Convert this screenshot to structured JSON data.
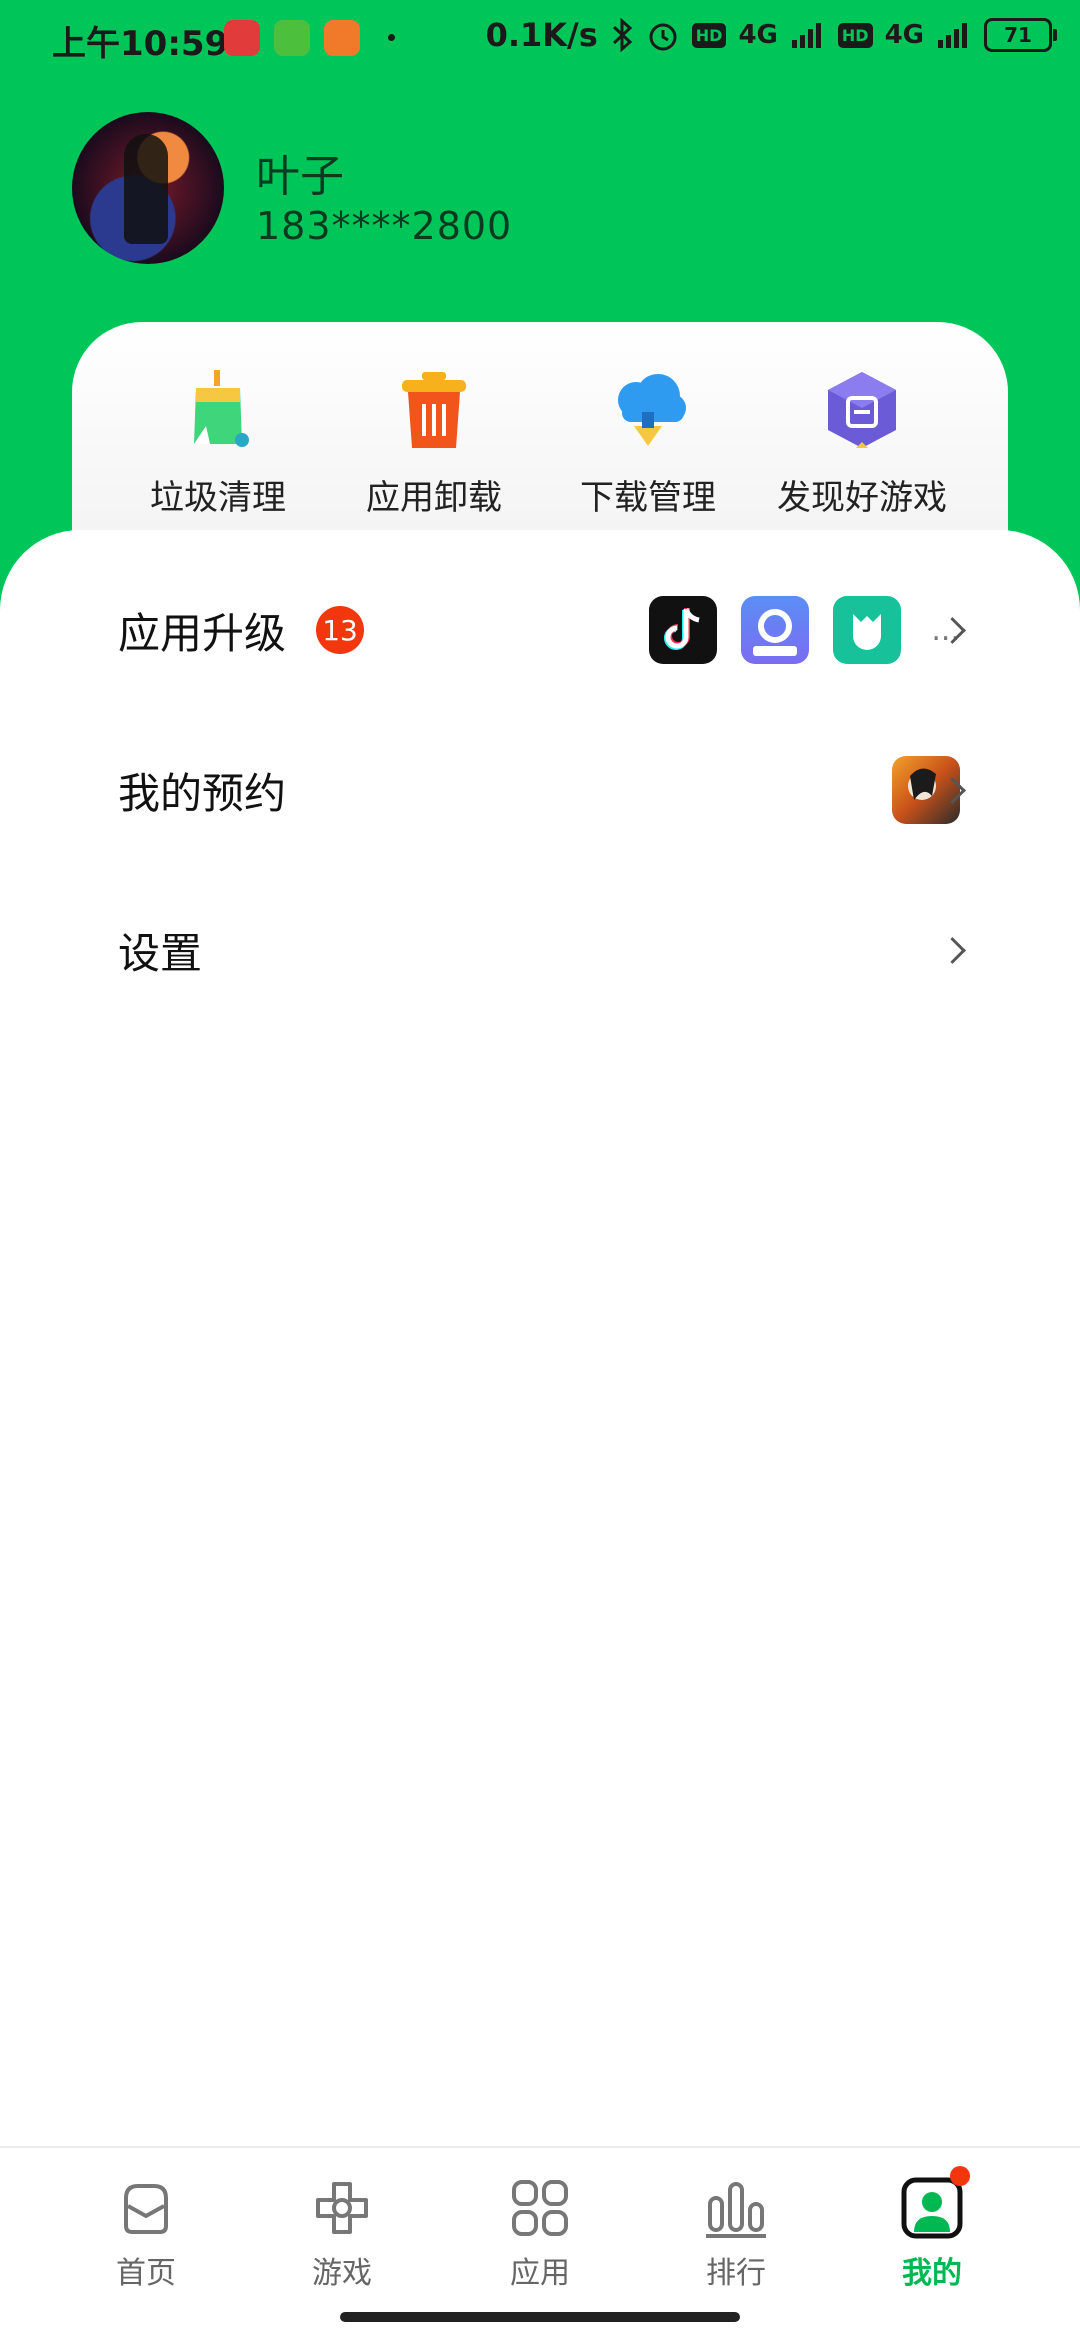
{
  "status_bar": {
    "time": "上午10:59",
    "net_speed": "0.1K/s",
    "hd1": "HD",
    "net1": "4G",
    "hd2": "HD",
    "net2": "4G",
    "battery": "71"
  },
  "profile": {
    "name": "叶子",
    "phone": "183****2800"
  },
  "tools": [
    {
      "label": "垃圾清理",
      "icon": "broom-icon"
    },
    {
      "label": "应用卸载",
      "icon": "trash-icon"
    },
    {
      "label": "下载管理",
      "icon": "cloud-download-icon"
    },
    {
      "label": "发现好游戏",
      "icon": "game-cube-icon"
    }
  ],
  "menu": {
    "upgrade": {
      "title": "应用升级",
      "badge": "13",
      "more": "..."
    },
    "reservation": {
      "title": "我的预约"
    },
    "settings": {
      "title": "设置"
    }
  },
  "nav": [
    {
      "label": "首页",
      "icon": "home-icon",
      "active": false
    },
    {
      "label": "游戏",
      "icon": "game-icon",
      "active": false
    },
    {
      "label": "应用",
      "icon": "apps-icon",
      "active": false
    },
    {
      "label": "排行",
      "icon": "ranking-icon",
      "active": false
    },
    {
      "label": "我的",
      "icon": "profile-icon",
      "active": true
    }
  ],
  "colors": {
    "brand": "#00c65a",
    "badge": "#f2360e",
    "active_nav": "#00b852"
  }
}
